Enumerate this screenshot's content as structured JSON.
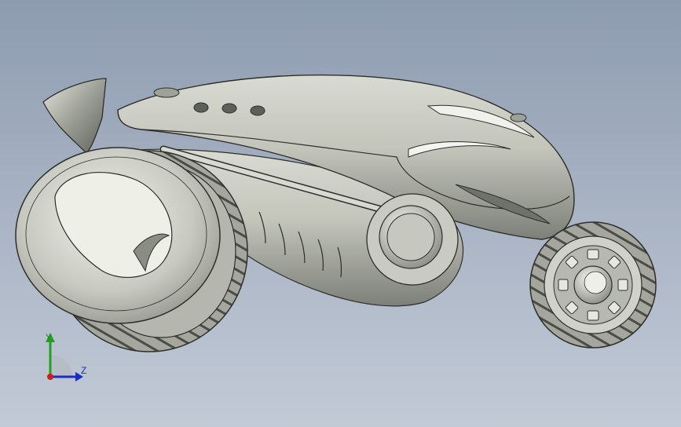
{
  "viewport": {
    "background_top": "#8e9cb0",
    "background_bottom": "#c2cad6"
  },
  "model": {
    "material_color": "#b9bcb0",
    "tire_color": "#8e9088"
  },
  "triad": {
    "y_label": "Y",
    "z_label": "Z",
    "y_color": "#22a022",
    "z_color": "#1a2fbf",
    "origin_color": "#d01c1c"
  }
}
